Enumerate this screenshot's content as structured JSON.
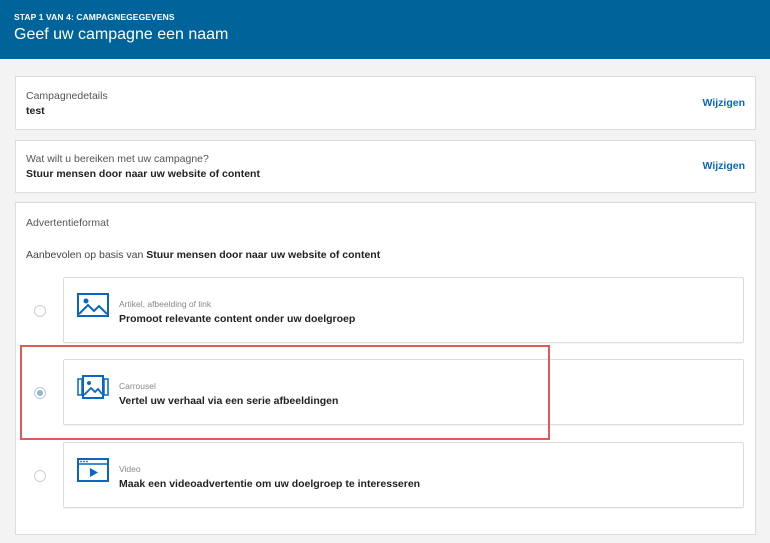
{
  "header": {
    "step": "STAP 1 VAN 4: CAMPAGNEGEGEVENS",
    "title": "Geef uw campagne een naam"
  },
  "campaign_details": {
    "label": "Campagnedetails",
    "value": "test",
    "edit_label": "Wijzigen"
  },
  "objective": {
    "label": "Wat wilt u bereiken met uw campagne?",
    "value": "Stuur mensen door naar uw website of content",
    "edit_label": "Wijzigen"
  },
  "ad_format": {
    "label": "Advertentieformat",
    "recommended_prefix": "Aanbevolen op basis van",
    "recommended_objective": "Stuur mensen door naar uw website of content",
    "options": [
      {
        "type": "Artikel, afbeelding of link",
        "description": "Promoot relevante content onder uw doelgroep",
        "icon": "image-icon",
        "selected": false
      },
      {
        "type": "Carrousel",
        "description": "Vertel uw verhaal via een serie afbeeldingen",
        "icon": "carousel-icon",
        "selected": true
      },
      {
        "type": "Video",
        "description": "Maak een videoadvertentie om uw doelgroep te interesseren",
        "icon": "video-icon",
        "selected": false
      }
    ]
  },
  "colors": {
    "header_bg": "#00639a",
    "link": "#0a66c2",
    "highlight_border": "#e05a5a"
  }
}
